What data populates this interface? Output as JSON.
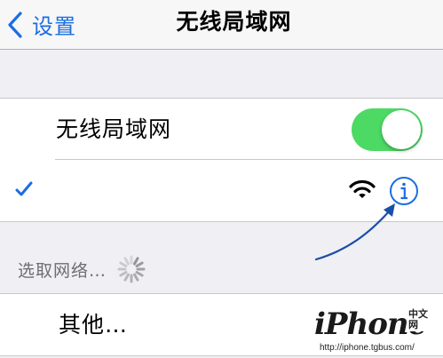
{
  "navbar": {
    "back_label": "设置",
    "title": "无线局域网",
    "back_icon": "chevron-left-icon"
  },
  "wifi_group": {
    "toggle_label": "无线局域网",
    "toggle_on": true,
    "connected_network": {
      "name": "",
      "checkmark_icon": "checkmark-icon",
      "signal_icon": "wifi-signal-icon",
      "info_icon": "info-icon"
    }
  },
  "networks_section": {
    "header": "选取网络…",
    "spinner_icon": "activity-spinner-icon"
  },
  "other_row": {
    "label": "其他…"
  },
  "watermark": {
    "logo": "iPhone",
    "badge": "中文网",
    "url": "http://iphone.tgbus.com/"
  },
  "colors": {
    "accent": "#1a6ee0",
    "toggle_on": "#4cd964",
    "background": "#efeff4",
    "annotation_arrow": "#1a4ea8"
  }
}
